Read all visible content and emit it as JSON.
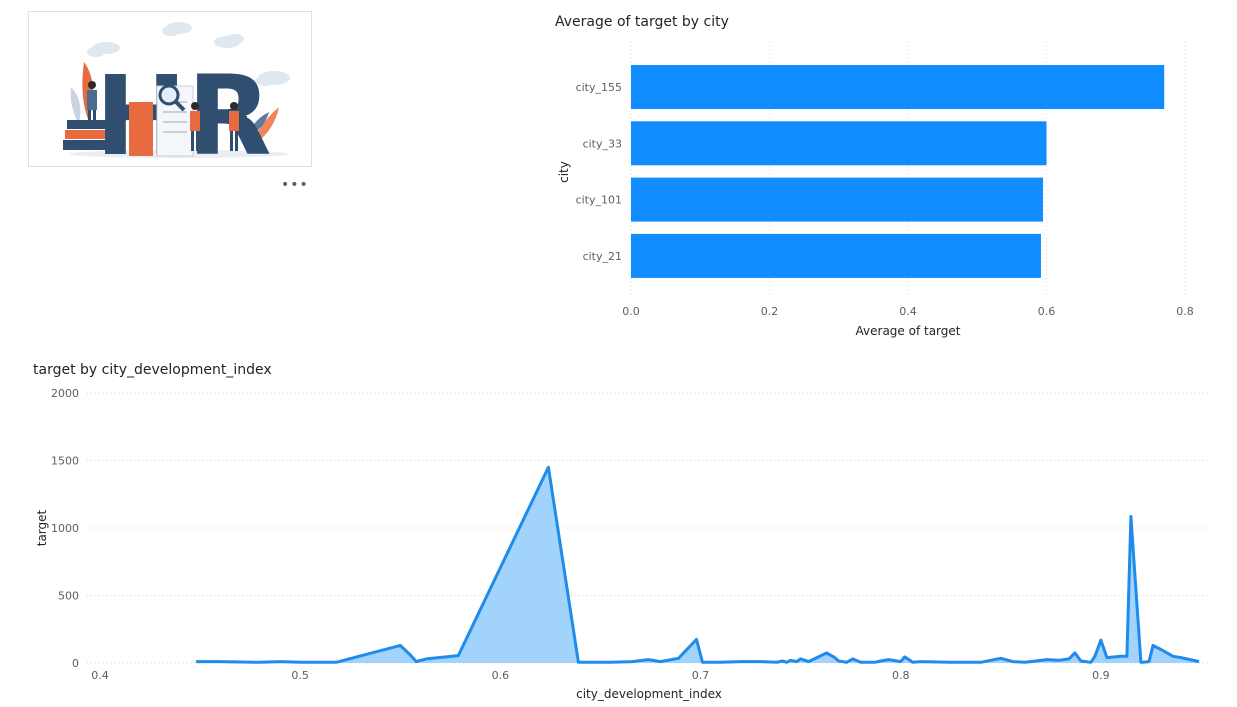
{
  "logo": {
    "text": "HR"
  },
  "visual_menu": {
    "label": "•••"
  },
  "colors": {
    "bar": "#118dff",
    "line": "#1f8bea",
    "area": "#a2d3fc",
    "grid": "#d9d9d9",
    "axis_text": "#605e5c",
    "title_text": "#252423"
  },
  "chart_data": [
    {
      "type": "bar",
      "orientation": "horizontal",
      "title": "Average of target by city",
      "xlabel": "Average of target",
      "ylabel": "city",
      "categories": [
        "city_155",
        "city_33",
        "city_101",
        "city_21"
      ],
      "values": [
        0.77,
        0.6,
        0.595,
        0.592
      ],
      "xlim": [
        0,
        0.8
      ],
      "xticks": [
        "0.0",
        "0.2",
        "0.4",
        "0.6",
        "0.8"
      ],
      "grid": "vertical dotted"
    },
    {
      "type": "area",
      "title": "target by city_development_index",
      "xlabel": "city_development_index",
      "ylabel": "target",
      "xlim": [
        0.4,
        0.95
      ],
      "ylim": [
        0,
        2000
      ],
      "xticks": [
        "0.4",
        "0.5",
        "0.6",
        "0.7",
        "0.8",
        "0.9"
      ],
      "yticks": [
        "0",
        "500",
        "1000",
        "1500",
        "2000"
      ],
      "grid": "horizontal dotted",
      "x": [
        0.448,
        0.46,
        0.48,
        0.49,
        0.5,
        0.51,
        0.518,
        0.527,
        0.55,
        0.555,
        0.558,
        0.563,
        0.579,
        0.624,
        0.639,
        0.647,
        0.655,
        0.666,
        0.674,
        0.68,
        0.689,
        0.698,
        0.701,
        0.71,
        0.72,
        0.73,
        0.738,
        0.741,
        0.743,
        0.745,
        0.748,
        0.75,
        0.754,
        0.763,
        0.767,
        0.769,
        0.773,
        0.776,
        0.78,
        0.787,
        0.79,
        0.794,
        0.8,
        0.802,
        0.806,
        0.81,
        0.825,
        0.84,
        0.85,
        0.856,
        0.862,
        0.865,
        0.873,
        0.879,
        0.884,
        0.887,
        0.89,
        0.895,
        0.897,
        0.9,
        0.903,
        0.91,
        0.913,
        0.915,
        0.92,
        0.921,
        0.924,
        0.926,
        0.93,
        0.936,
        0.94,
        0.949
      ],
      "y": [
        10,
        10,
        5,
        10,
        5,
        5,
        5,
        40,
        130,
        60,
        10,
        30,
        55,
        1450,
        5,
        5,
        5,
        10,
        25,
        10,
        35,
        175,
        5,
        5,
        10,
        10,
        5,
        15,
        5,
        20,
        10,
        30,
        10,
        75,
        40,
        15,
        5,
        30,
        5,
        5,
        15,
        25,
        10,
        45,
        5,
        10,
        5,
        5,
        35,
        10,
        5,
        10,
        25,
        20,
        30,
        75,
        15,
        5,
        50,
        170,
        40,
        50,
        50,
        1085,
        5,
        5,
        10,
        130,
        100,
        50,
        40,
        10
      ]
    }
  ]
}
